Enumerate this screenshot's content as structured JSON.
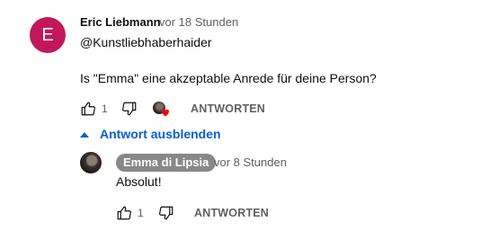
{
  "comment": {
    "avatar_letter": "E",
    "author": "Eric Liebmann",
    "time": "vor 18 Stunden",
    "text_line1": "@Kunstliebhaberhaider",
    "text_line2": "Is \"Emma\" eine akzeptable Anrede für deine Person?",
    "like_count": "1",
    "reply_label": "ANTWORTEN",
    "hearted": true
  },
  "replies_toggle": {
    "label": "Antwort ausblenden"
  },
  "reply": {
    "author": "Emma di Lipsia",
    "time": "vor 8 Stunden",
    "text": "Absolut!",
    "like_count": "1",
    "reply_label": "ANTWORTEN"
  },
  "colors": {
    "avatar_bg": "#c2185b",
    "link_blue": "#065fd4",
    "heart": "#ff0000",
    "author_badge_bg": "#888888"
  }
}
